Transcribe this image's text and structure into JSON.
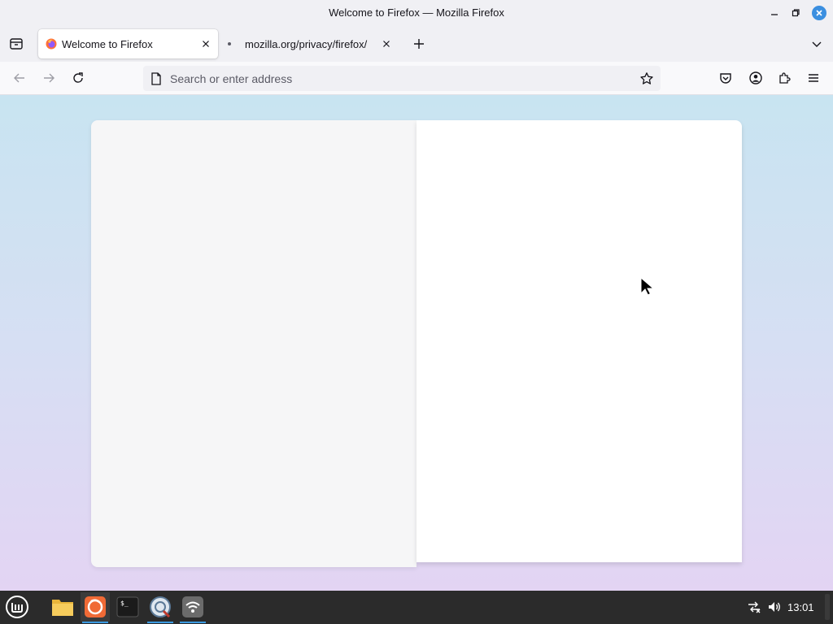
{
  "window": {
    "title": "Welcome to Firefox — Mozilla Firefox"
  },
  "tabs": [
    {
      "label": "Welcome to Firefox",
      "active": true,
      "icon": "firefox-icon"
    },
    {
      "label": "mozilla.org/privacy/firefox/",
      "active": false
    }
  ],
  "toolbar": {
    "url_placeholder": "Search or enter address",
    "url_value": "",
    "icons": [
      "back-icon",
      "forward-icon",
      "reload-icon",
      "bookmark-star-icon",
      "pocket-icon",
      "account-icon",
      "extensions-icon",
      "menu-icon"
    ]
  },
  "taskbar": {
    "apps": [
      "mint-menu-icon",
      "files-icon",
      "firefox-icon",
      "terminal-icon",
      "update-manager-icon",
      "network-icon"
    ],
    "clock": "13:01"
  },
  "colors": {
    "accent": "#3b8fe0",
    "taskbar_bg": "#2b2b2b",
    "active_underline": "#3b9ae1"
  }
}
